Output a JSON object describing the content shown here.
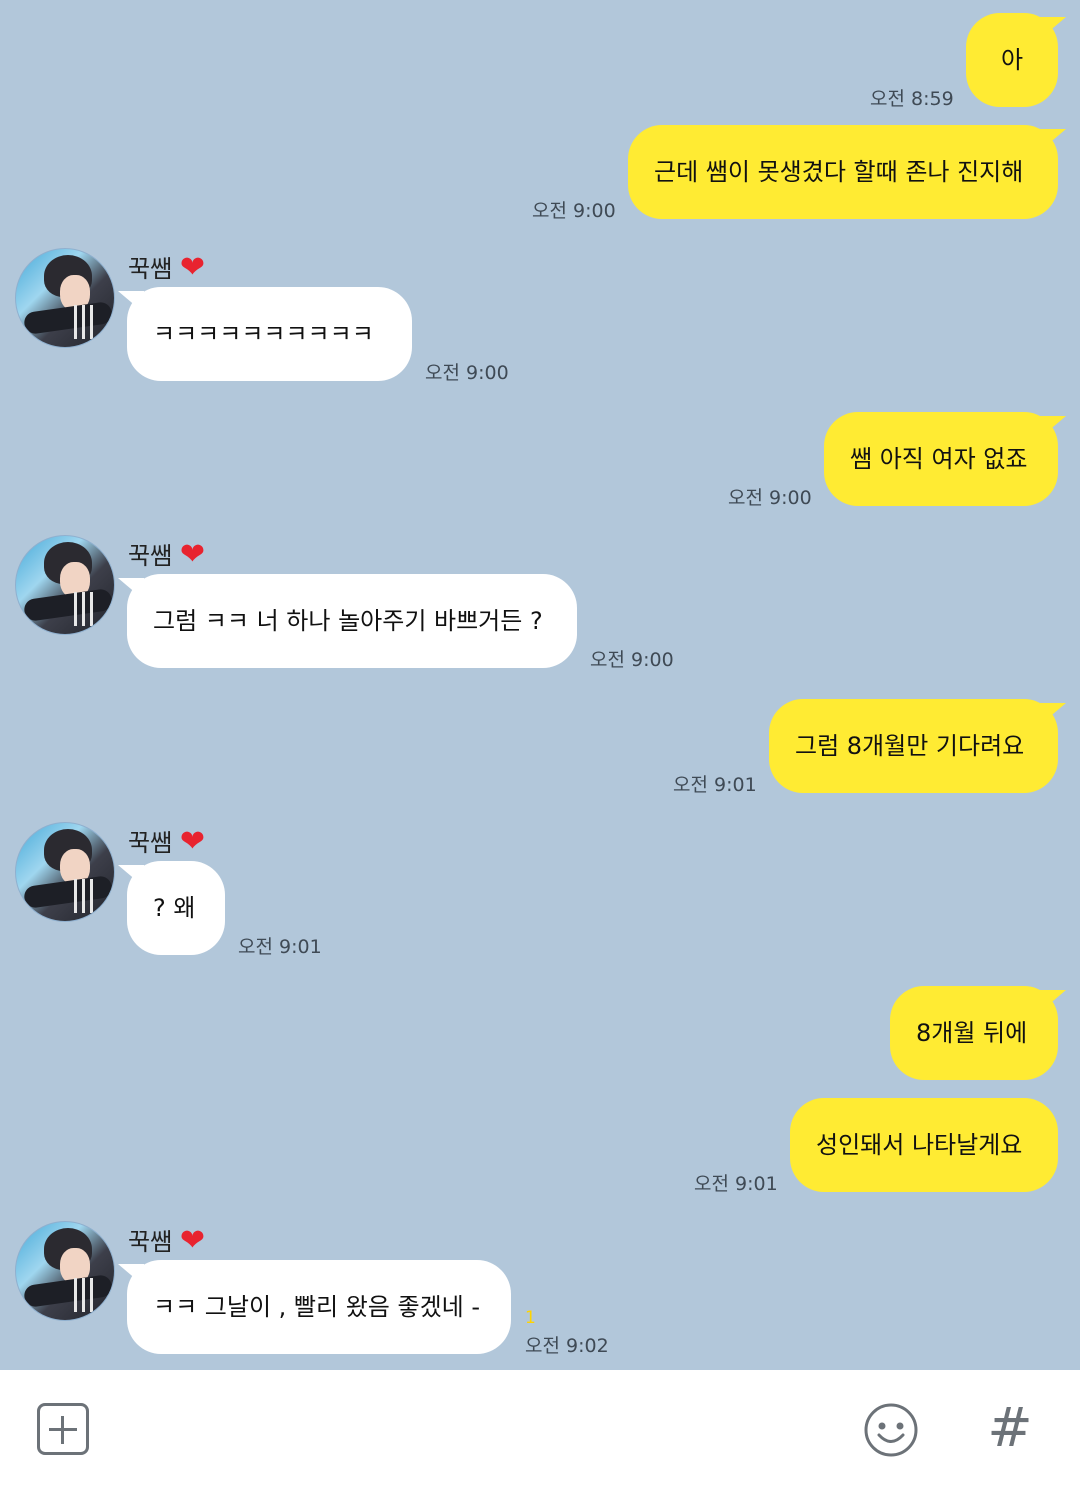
{
  "contact": {
    "name": "꾹쌤",
    "heart": "❤"
  },
  "messages": [
    {
      "side": "me",
      "text": "아",
      "time": "오전 8:59"
    },
    {
      "side": "me",
      "text": "근데 쌤이 못생겼다 할때 존나 진지해",
      "time": "오전 9:00"
    },
    {
      "side": "them",
      "text": "ㅋㅋㅋㅋㅋㅋㅋㅋㅋㅋ",
      "time": "오전 9:00"
    },
    {
      "side": "me",
      "text": "쌤 아직 여자 없죠",
      "time": "오전 9:00"
    },
    {
      "side": "them",
      "text": "그럼 ㅋㅋ 너 하나 놀아주기 바쁘거든 ?",
      "time": "오전 9:00"
    },
    {
      "side": "me",
      "text": "그럼 8개월만 기다려요",
      "time": "오전 9:01"
    },
    {
      "side": "them",
      "text": "? 왜",
      "time": "오전 9:01"
    },
    {
      "side": "me",
      "text": "8개월 뒤에",
      "time": ""
    },
    {
      "side": "me",
      "text": "성인돼서 나타날게요",
      "time": "오전 9:01"
    },
    {
      "side": "them",
      "text": "ㅋㅋ 그날이 , 빨리 왔음 좋겠네 -",
      "time": "오전 9:02",
      "unread": "1"
    }
  ],
  "input_bar": {
    "icons": [
      "plus-square-icon",
      "smiley-icon",
      "hashtag-icon"
    ],
    "hash_glyph": "#"
  },
  "colors": {
    "background": "#b2c7da",
    "my_bubble": "#ffeb33",
    "their_bubble": "#ffffff",
    "unread": "#ffd400"
  }
}
